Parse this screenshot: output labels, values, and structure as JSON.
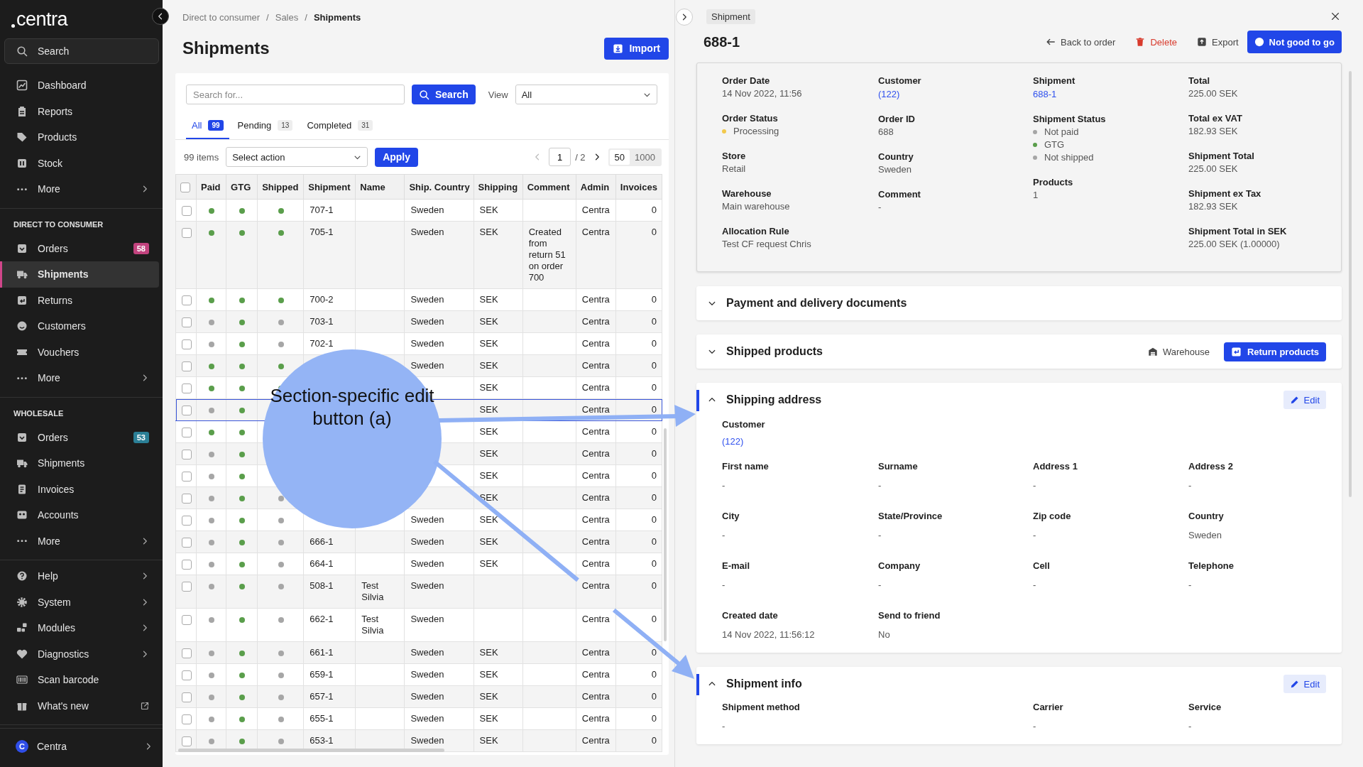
{
  "sidebar": {
    "logo": "centra",
    "search": "Search",
    "sections": [
      {
        "items": [
          {
            "label": "Dashboard",
            "selected": false,
            "kind": "plain"
          },
          {
            "label": "Reports",
            "selected": false,
            "kind": "plain"
          },
          {
            "label": "Products",
            "selected": false,
            "kind": "plain"
          },
          {
            "label": "Stock",
            "selected": false,
            "kind": "plain"
          },
          {
            "label": "More",
            "selected": false,
            "kind": "submenu"
          }
        ]
      },
      {
        "heading": "DIRECT TO CONSUMER",
        "items": [
          {
            "label": "Orders",
            "selected": false,
            "kind": "plain",
            "badge": "58",
            "color": "#c2437e"
          },
          {
            "label": "Shipments",
            "selected": true,
            "kind": "plain"
          },
          {
            "label": "Returns",
            "selected": false,
            "kind": "plain"
          },
          {
            "label": "Customers",
            "selected": false,
            "kind": "plain"
          },
          {
            "label": "Vouchers",
            "selected": false,
            "kind": "plain"
          },
          {
            "label": "More",
            "selected": false,
            "kind": "submenu"
          }
        ]
      },
      {
        "heading": "WHOLESALE",
        "items": [
          {
            "label": "Orders",
            "selected": false,
            "kind": "plain",
            "badge": "53",
            "color": "#2b7f96"
          },
          {
            "label": "Shipments",
            "selected": false,
            "kind": "plain"
          },
          {
            "label": "Invoices",
            "selected": false,
            "kind": "plain"
          },
          {
            "label": "Accounts",
            "selected": false,
            "kind": "plain"
          },
          {
            "label": "More",
            "selected": false,
            "kind": "submenu"
          }
        ]
      },
      {
        "items": [
          {
            "label": "Help",
            "selected": false,
            "kind": "submenu"
          },
          {
            "label": "System",
            "selected": false,
            "kind": "submenu"
          },
          {
            "label": "Modules",
            "selected": false,
            "kind": "submenu"
          },
          {
            "label": "Diagnostics",
            "selected": false,
            "kind": "submenu"
          },
          {
            "label": "Scan barcode",
            "selected": false,
            "kind": "plain"
          },
          {
            "label": "What's new",
            "selected": false,
            "kind": "external"
          }
        ]
      }
    ],
    "account": {
      "initial": "C",
      "label": "Centra"
    }
  },
  "breadcrumbs": {
    "separator": "/",
    "items": [
      "Direct to consumer",
      "Sales",
      "Shipments"
    ]
  },
  "page_title": "Shipments",
  "import_button": "Import",
  "search": {
    "placeholder": "Search for...",
    "button": "Search",
    "view_label": "View",
    "view_value": "All"
  },
  "tabs": [
    {
      "label": "All",
      "count": "99",
      "selected": true
    },
    {
      "label": "Pending",
      "count": "13",
      "selected": false
    },
    {
      "label": "Completed",
      "count": "31",
      "selected": false
    }
  ],
  "toolbar": {
    "items_count": "99 items",
    "action_placeholder": "Select action",
    "apply": "Apply",
    "pager": {
      "prev_disabled": true,
      "page": "1",
      "total": "/ 2"
    },
    "page_sizes": [
      {
        "label": "50",
        "selected": true
      },
      {
        "label": "1000",
        "selected": false
      }
    ]
  },
  "table": {
    "select_all_checked": false,
    "columns": [
      "Paid",
      "GTG",
      "Shipped",
      "Shipment",
      "Name",
      "Ship. Country",
      "Shipping",
      "Comment",
      "Admin",
      "Invoices"
    ],
    "rows": [
      {
        "selected": false,
        "paid": true,
        "gtg": true,
        "shipped": true,
        "shipment": "707-1",
        "country": "Sweden",
        "shipping": "SEK",
        "admin": "Centra",
        "invoices": "0"
      },
      {
        "selected": false,
        "paid": true,
        "gtg": true,
        "shipped": true,
        "shipment": "705-1",
        "country": "Sweden",
        "shipping": "SEK",
        "comment": "Created from return 51 on order 700",
        "admin": "Centra",
        "invoices": "0"
      },
      {
        "selected": false,
        "paid": true,
        "gtg": true,
        "shipped": true,
        "shipment": "700-2",
        "country": "Sweden",
        "shipping": "SEK",
        "admin": "Centra",
        "invoices": "0"
      },
      {
        "selected": false,
        "paid": false,
        "gtg": true,
        "shipped": false,
        "shipment": "703-1",
        "country": "Sweden",
        "shipping": "SEK",
        "admin": "Centra",
        "invoices": "0"
      },
      {
        "selected": false,
        "paid": false,
        "gtg": true,
        "shipped": false,
        "shipment": "702-1",
        "country": "Sweden",
        "shipping": "SEK",
        "admin": "Centra",
        "invoices": "0"
      },
      {
        "selected": false,
        "paid": true,
        "gtg": true,
        "shipped": true,
        "country": "Sweden",
        "shipping": "SEK",
        "admin": "Centra",
        "invoices": "0"
      },
      {
        "selected": false,
        "paid": true,
        "gtg": true,
        "shipped": true,
        "shipping": "SEK",
        "admin": "Centra",
        "invoices": "0"
      },
      {
        "selected": true,
        "paid": false,
        "gtg": true,
        "shipping": "SEK",
        "admin": "Centra",
        "invoices": "0"
      },
      {
        "selected": false,
        "paid": true,
        "gtg": true,
        "shipping": "SEK",
        "admin": "Centra",
        "invoices": "0"
      },
      {
        "selected": false,
        "paid": false,
        "gtg": true,
        "shipping": "SEK",
        "admin": "Centra",
        "invoices": "0"
      },
      {
        "selected": false,
        "paid": false,
        "gtg": true,
        "shipping": "SEK",
        "admin": "Centra",
        "invoices": "0"
      },
      {
        "selected": false,
        "paid": false,
        "gtg": true,
        "shipped": false,
        "shipping": "SEK",
        "admin": "Centra",
        "invoices": "0"
      },
      {
        "selected": false,
        "paid": false,
        "gtg": true,
        "shipped": false,
        "country": "Sweden",
        "shipping": "SEK",
        "admin": "Centra",
        "invoices": "0"
      },
      {
        "selected": false,
        "paid": false,
        "gtg": true,
        "shipped": false,
        "shipment": "666-1",
        "country": "Sweden",
        "shipping": "SEK",
        "admin": "Centra",
        "invoices": "0"
      },
      {
        "selected": false,
        "paid": false,
        "gtg": true,
        "shipped": false,
        "shipment": "664-1",
        "country": "Sweden",
        "shipping": "SEK",
        "admin": "Centra",
        "invoices": "0"
      },
      {
        "selected": false,
        "paid": false,
        "gtg": true,
        "shipped": false,
        "shipment": "508-1",
        "name": "Test Silvia",
        "country": "Sweden",
        "admin": "Centra",
        "invoices": "0"
      },
      {
        "selected": false,
        "paid": false,
        "gtg": true,
        "shipped": false,
        "shipment": "662-1",
        "name": "Test Silvia",
        "country": "Sweden",
        "admin": "Centra",
        "invoices": "0"
      },
      {
        "selected": false,
        "paid": false,
        "gtg": true,
        "shipped": false,
        "shipment": "661-1",
        "country": "Sweden",
        "shipping": "SEK",
        "admin": "Centra",
        "invoices": "0"
      },
      {
        "selected": false,
        "paid": false,
        "gtg": true,
        "shipped": false,
        "shipment": "659-1",
        "country": "Sweden",
        "shipping": "SEK",
        "admin": "Centra",
        "invoices": "0"
      },
      {
        "selected": false,
        "paid": false,
        "gtg": true,
        "shipped": false,
        "shipment": "657-1",
        "country": "Sweden",
        "shipping": "SEK",
        "admin": "Centra",
        "invoices": "0"
      },
      {
        "selected": false,
        "paid": false,
        "gtg": true,
        "shipped": false,
        "shipment": "655-1",
        "country": "Sweden",
        "shipping": "SEK",
        "admin": "Centra",
        "invoices": "0"
      },
      {
        "selected": false,
        "paid": false,
        "gtg": true,
        "shipped": false,
        "shipment": "653-1",
        "country": "Sweden",
        "shipping": "SEK",
        "admin": "Centra",
        "invoices": "0"
      }
    ]
  },
  "drawer": {
    "tag": "Shipment",
    "title": "688-1",
    "actions": [
      {
        "kind": "back",
        "label": "Back to order"
      },
      {
        "kind": "danger",
        "label": "Delete"
      },
      {
        "kind": "export",
        "label": "Export"
      },
      {
        "kind": "primary",
        "label": "Not good to go"
      }
    ],
    "info": [
      [
        {
          "label": "Order Date",
          "kind": "text",
          "value": "14 Nov 2022, 11:56"
        },
        {
          "label": "Order Status",
          "kind": "status",
          "statuses": [
            {
              "label": "Processing",
              "color": "#f2c94c"
            }
          ]
        },
        {
          "label": "Store",
          "kind": "text",
          "value": "Retail"
        },
        {
          "label": "Warehouse",
          "kind": "text",
          "value": "Main warehouse"
        },
        {
          "label": "Allocation Rule",
          "kind": "text",
          "value": "Test CF request Chris"
        }
      ],
      [
        {
          "label": "Customer",
          "kind": "link",
          "value": "(122)"
        },
        {
          "label": "Order ID",
          "kind": "text",
          "value": "688"
        },
        {
          "label": "Country",
          "kind": "text",
          "value": "Sweden"
        },
        {
          "label": "Comment",
          "kind": "text",
          "value": "-"
        }
      ],
      [
        {
          "label": "Shipment",
          "kind": "link",
          "value": "688-1"
        },
        {
          "label": "Shipment Status",
          "kind": "status",
          "statuses": [
            {
              "label": "Not paid",
              "color": "#a6a6a6"
            },
            {
              "label": "GTG",
              "color": "#5a9e4b"
            },
            {
              "label": "Not shipped",
              "color": "#a6a6a6"
            }
          ]
        },
        {
          "label": "Products",
          "kind": "text",
          "value": "1"
        }
      ],
      [
        {
          "label": "Total",
          "kind": "text",
          "value": "225.00 SEK"
        },
        {
          "label": "Total ex VAT",
          "kind": "text",
          "value": "182.93 SEK"
        },
        {
          "label": "Shipment Total",
          "kind": "text",
          "value": "225.00 SEK"
        },
        {
          "label": "Shipment ex Tax",
          "kind": "text",
          "value": "182.93 SEK"
        },
        {
          "label": "Shipment Total in SEK",
          "kind": "text",
          "value": "225.00 SEK (1.00000)"
        }
      ]
    ],
    "sections": [
      {
        "title": "Payment and delivery documents",
        "expanded": false,
        "highlighted": false
      },
      {
        "title": "Shipped products",
        "expanded": false,
        "highlighted": false,
        "actions": [
          {
            "kind": "link",
            "label": "Warehouse"
          },
          {
            "kind": "primary",
            "label": "Return products"
          }
        ]
      },
      {
        "title": "Shipping address",
        "expanded": true,
        "highlighted": true,
        "actions": [
          {
            "kind": "edit",
            "label": "Edit"
          }
        ],
        "customer": {
          "label": "Customer",
          "value": "(122)"
        },
        "fields": [
          {
            "label": "First name",
            "value": "-"
          },
          {
            "label": "Surname",
            "value": "-"
          },
          {
            "label": "Address 1",
            "value": "-"
          },
          {
            "label": "Address 2",
            "value": "-"
          },
          {
            "label": "City",
            "value": "-"
          },
          {
            "label": "State/Province",
            "value": "-"
          },
          {
            "label": "Zip code",
            "value": "-"
          },
          {
            "label": "Country",
            "value": "Sweden"
          },
          {
            "label": "E-mail",
            "value": "-"
          },
          {
            "label": "Company",
            "value": "-"
          },
          {
            "label": "Cell",
            "value": "-"
          },
          {
            "label": "Telephone",
            "value": "-"
          },
          {
            "label": "Created date",
            "value": "14 Nov 2022, 11:56:12"
          },
          {
            "label": "Send to friend",
            "value": "No"
          }
        ]
      },
      {
        "title": "Shipment info",
        "expanded": true,
        "highlighted": true,
        "actions": [
          {
            "kind": "edit",
            "label": "Edit"
          }
        ],
        "fields": [
          {
            "label": "Shipment method",
            "value": "-",
            "wide": true
          },
          {
            "label": "Carrier",
            "value": "-"
          },
          {
            "label": "Service",
            "value": "-"
          }
        ]
      }
    ]
  },
  "annotation": {
    "text": "Section-specific edit button (a)"
  }
}
